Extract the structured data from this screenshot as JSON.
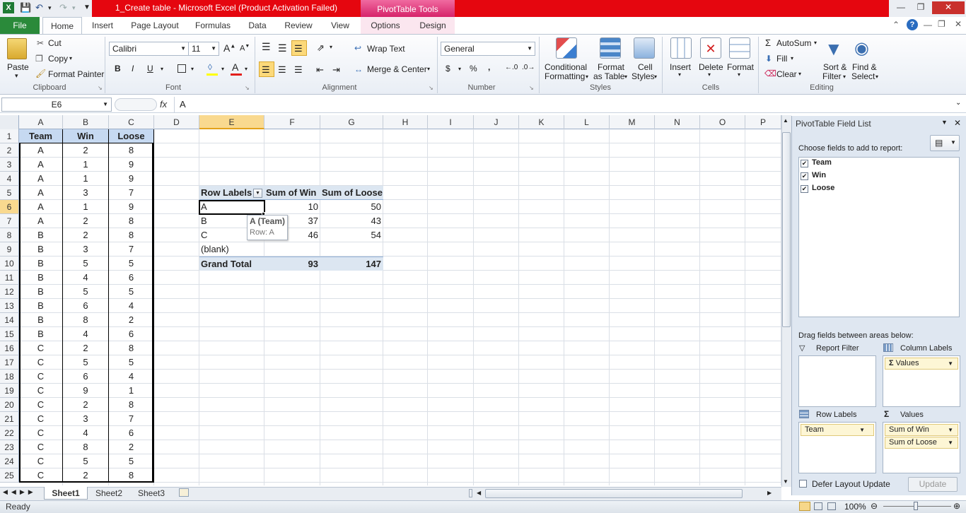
{
  "window": {
    "title": "1_Create table  -  Microsoft Excel (Product Activation Failed)",
    "context_tab_group": "PivotTable Tools"
  },
  "tabs": [
    "File",
    "Home",
    "Insert",
    "Page Layout",
    "Formulas",
    "Data",
    "Review",
    "View",
    "Options",
    "Design"
  ],
  "ribbon": {
    "clipboard": {
      "paste": "Paste",
      "cut": "Cut",
      "copy": "Copy",
      "format_painter": "Format Painter",
      "group": "Clipboard"
    },
    "font": {
      "name": "Calibri",
      "size": "11",
      "bold": "B",
      "italic": "I",
      "underline": "U",
      "group": "Font"
    },
    "alignment": {
      "wrap": "Wrap Text",
      "merge": "Merge & Center",
      "group": "Alignment"
    },
    "number": {
      "format": "General",
      "currency": "$",
      "percent": "%",
      "comma": ",",
      "group": "Number"
    },
    "styles": {
      "conditional": "Conditional",
      "conditional2": "Formatting",
      "format_table": "Format",
      "format_table2": "as Table",
      "cell_styles": "Cell",
      "cell_styles2": "Styles",
      "group": "Styles"
    },
    "cells": {
      "insert": "Insert",
      "delete": "Delete",
      "format": "Format",
      "group": "Cells"
    },
    "editing": {
      "autosum": "AutoSum",
      "fill": "Fill",
      "clear": "Clear",
      "sort": "Sort &",
      "sort2": "Filter",
      "find": "Find &",
      "find2": "Select",
      "group": "Editing"
    }
  },
  "formula_bar": {
    "name_box": "E6",
    "fx": "fx",
    "value": "A"
  },
  "columns": [
    "A",
    "B",
    "C",
    "D",
    "E",
    "F",
    "G",
    "H",
    "I",
    "J",
    "K",
    "L",
    "M",
    "N",
    "O",
    "P"
  ],
  "rows": [
    "1",
    "2",
    "3",
    "4",
    "5",
    "6",
    "7",
    "8",
    "9",
    "10",
    "11",
    "12",
    "13",
    "14",
    "15",
    "16",
    "17",
    "18",
    "19",
    "20",
    "21",
    "22",
    "23",
    "24",
    "25"
  ],
  "table": {
    "headers": [
      "Team",
      "Win",
      "Loose"
    ],
    "data": [
      [
        "A",
        "2",
        "8"
      ],
      [
        "A",
        "1",
        "9"
      ],
      [
        "A",
        "1",
        "9"
      ],
      [
        "A",
        "3",
        "7"
      ],
      [
        "A",
        "1",
        "9"
      ],
      [
        "A",
        "2",
        "8"
      ],
      [
        "B",
        "2",
        "8"
      ],
      [
        "B",
        "3",
        "7"
      ],
      [
        "B",
        "5",
        "5"
      ],
      [
        "B",
        "4",
        "6"
      ],
      [
        "B",
        "5",
        "5"
      ],
      [
        "B",
        "6",
        "4"
      ],
      [
        "B",
        "8",
        "2"
      ],
      [
        "B",
        "4",
        "6"
      ],
      [
        "C",
        "2",
        "8"
      ],
      [
        "C",
        "5",
        "5"
      ],
      [
        "C",
        "6",
        "4"
      ],
      [
        "C",
        "9",
        "1"
      ],
      [
        "C",
        "2",
        "8"
      ],
      [
        "C",
        "3",
        "7"
      ],
      [
        "C",
        "4",
        "6"
      ],
      [
        "C",
        "8",
        "2"
      ],
      [
        "C",
        "5",
        "5"
      ],
      [
        "C",
        "2",
        "8"
      ]
    ]
  },
  "pivot": {
    "headers": [
      "Row Labels",
      "Sum of Win",
      "Sum of Loose"
    ],
    "rows": [
      [
        "A",
        "10",
        "50"
      ],
      [
        "B",
        "37",
        "43"
      ],
      [
        "C",
        "46",
        "54"
      ],
      [
        "(blank)",
        "",
        ""
      ]
    ],
    "total": [
      "Grand Total",
      "93",
      "147"
    ],
    "tooltip_title": "A (Team)",
    "tooltip_sub": "Row: A"
  },
  "field_list": {
    "title": "PivotTable Field List",
    "choose": "Choose fields to add to report:",
    "fields": [
      "Team",
      "Win",
      "Loose"
    ],
    "drag": "Drag fields between areas below:",
    "report_filter": "Report Filter",
    "column_labels": "Column Labels",
    "row_labels": "Row Labels",
    "values": "Values",
    "col_field": "Values",
    "row_field": "Team",
    "value_fields": [
      "Sum of Win",
      "Sum of Loose"
    ],
    "defer": "Defer Layout Update",
    "update": "Update"
  },
  "sheets": [
    "Sheet1",
    "Sheet2",
    "Sheet3"
  ],
  "status": {
    "ready": "Ready",
    "zoom": "100%"
  }
}
